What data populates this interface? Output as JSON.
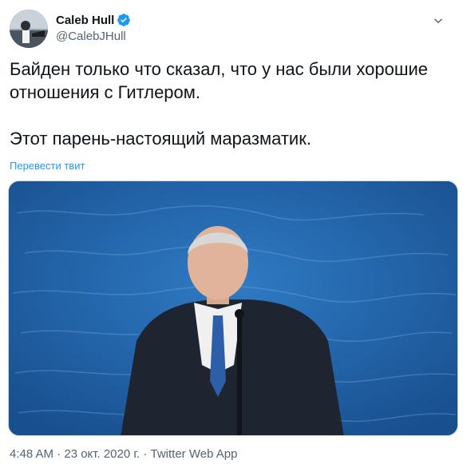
{
  "author": {
    "display_name": "Caleb Hull",
    "handle": "@CalebJHull"
  },
  "icons": {
    "verified": "verified-badge-icon",
    "more": "chevron-down-icon"
  },
  "tweet": {
    "text": "Байден только что сказал, что у нас были хорошие\nотношения с Гитлером.\n\nЭтот парень-настоящий маразматик.",
    "translate_label": "Перевести твит"
  },
  "meta": {
    "timestamp": "4:48 AM · 23 окт. 2020 г. · Twitter Web App"
  },
  "colors": {
    "accent": "#1d9bf0",
    "video_background": "#1f62a6"
  }
}
